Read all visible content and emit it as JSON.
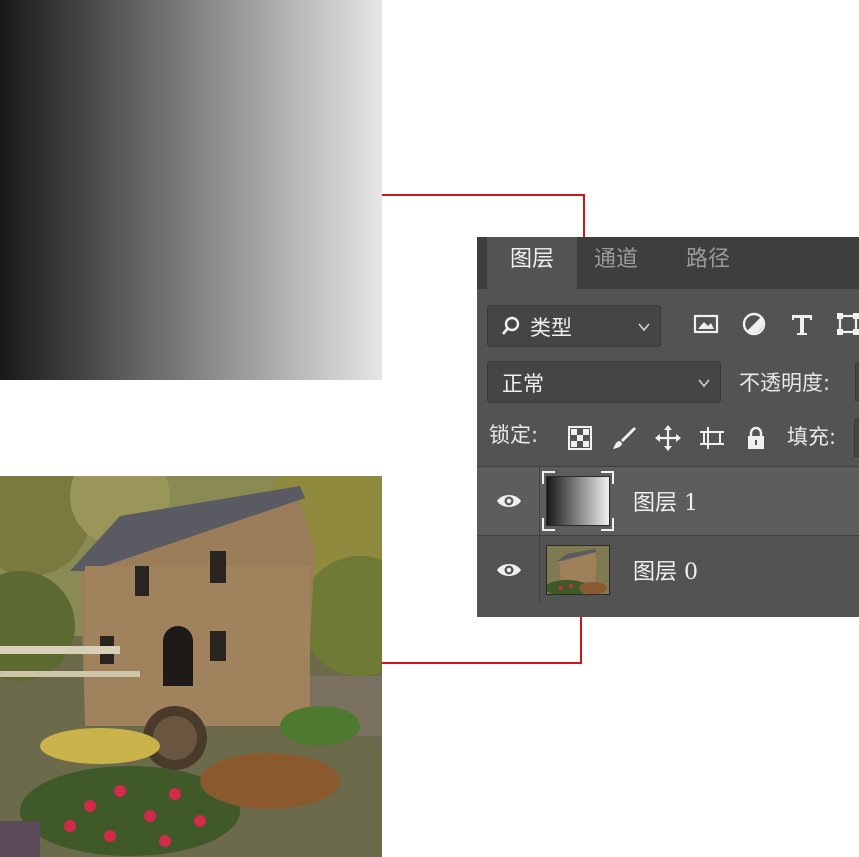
{
  "layers_panel": {
    "tabs": [
      {
        "label": "图层",
        "active": true
      },
      {
        "label": "通道",
        "active": false
      },
      {
        "label": "路径",
        "active": false
      }
    ],
    "filter": {
      "label": "类型",
      "icons": [
        "image-filter-icon",
        "adjustment-filter-icon",
        "text-filter-icon",
        "shape-filter-icon"
      ]
    },
    "blend_mode": {
      "value": "正常"
    },
    "opacity_label": "不透明度:",
    "lock": {
      "label": "锁定:",
      "icons": [
        "lock-transparent-icon",
        "lock-pixels-icon",
        "lock-position-icon",
        "lock-artboard-icon",
        "lock-all-icon"
      ]
    },
    "fill_label": "填充:",
    "layers": [
      {
        "name_prefix": "图层",
        "name_suffix": " 1",
        "visible": true,
        "thumbnail": "gradient",
        "selected": true
      },
      {
        "name_prefix": "图层",
        "name_suffix": " 0",
        "visible": true,
        "thumbnail": "mill-photo",
        "selected": false
      }
    ]
  },
  "colors": {
    "panel_bg": "#535353",
    "tab_bar_bg": "#3e3e3e",
    "connector_line": "#d0141c",
    "gradient_start": "#181818",
    "gradient_end": "#e6e6e6"
  }
}
